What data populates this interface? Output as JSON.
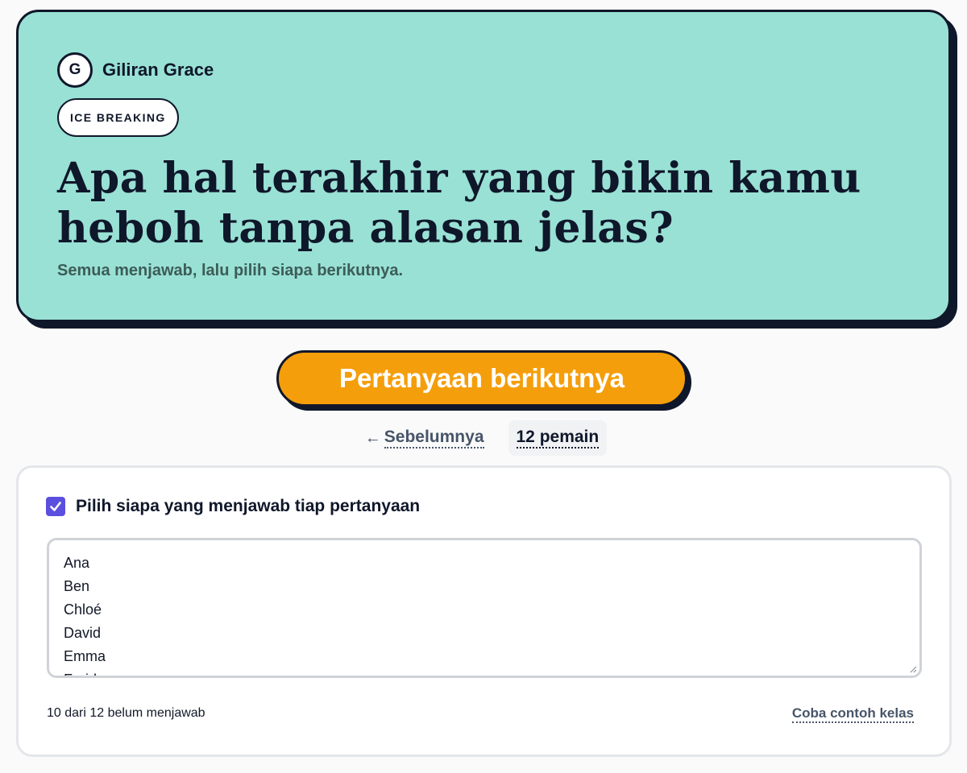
{
  "turn": {
    "avatar_initial": "G",
    "label": "Giliran Grace"
  },
  "question": {
    "category": "ICE BREAKING",
    "text": "Apa hal terakhir yang bikin kamu heboh tanpa alasan jelas?",
    "instructions": "Semua menjawab, lalu pilih siapa berikutnya."
  },
  "actions": {
    "next_label": "Pertanyaan berikutnya",
    "prev_arrow": "←",
    "prev_label": "Sebelumnya",
    "players_label": "12 pemain"
  },
  "settings": {
    "pick_answerer_label": "Pilih siapa yang menjawab tiap pertanyaan",
    "pick_answerer_checked": true,
    "players": [
      "Ana",
      "Ben",
      "Chloé",
      "David",
      "Emma",
      "Farid"
    ],
    "status": "10 dari 12 belum menjawab",
    "sample_class_label": "Coba contoh kelas"
  },
  "colors": {
    "card_background": "#99e1d5",
    "button_orange": "#f59e0b",
    "checkbox_accent": "#5b4fe0",
    "ink": "#0f172a"
  },
  "icons": {
    "checkbox": "check-icon",
    "resize": "resize-grip-icon"
  }
}
